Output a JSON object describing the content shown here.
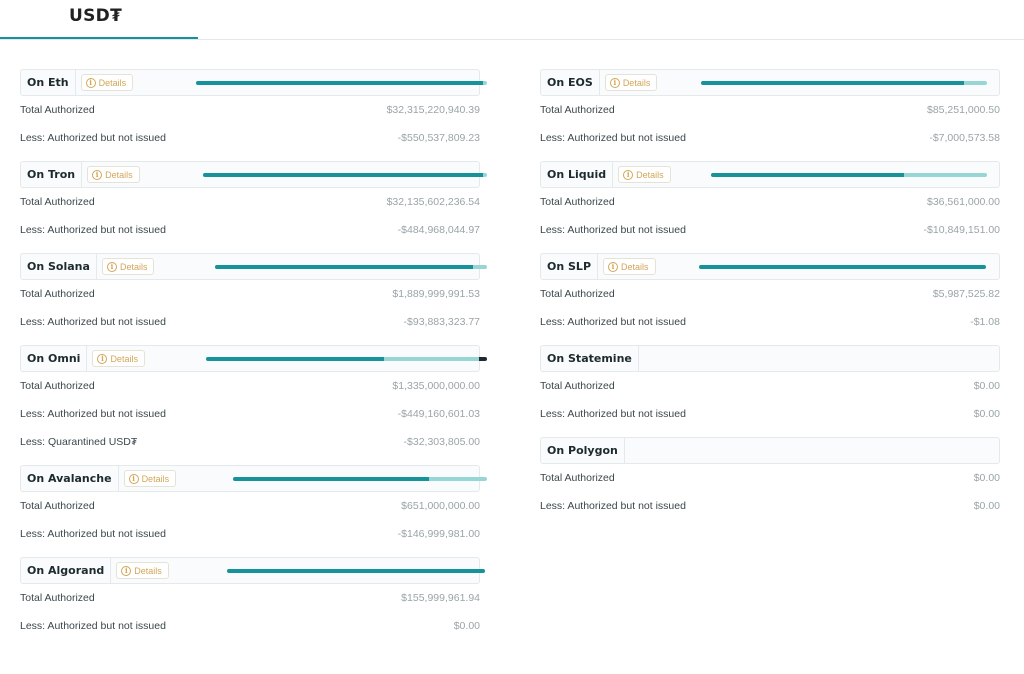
{
  "tab": {
    "title": "USD₮"
  },
  "details_label": "Details",
  "colors": {
    "issued": "#16929a",
    "unissued": "#98d6d6",
    "quarantined": "#1d2a2e"
  },
  "left_column": [
    {
      "name": "On Eth",
      "has_details": true,
      "allocation": [
        0.985,
        0.015,
        0
      ],
      "rows": [
        {
          "label": "Total Authorized",
          "value": "$32,315,220,940.39"
        },
        {
          "label": "Less: Authorized but not issued",
          "value": "-$550,537,809.23"
        }
      ]
    },
    {
      "name": "On Tron",
      "has_details": true,
      "allocation": [
        0.985,
        0.015,
        0
      ],
      "rows": [
        {
          "label": "Total Authorized",
          "value": "$32,135,602,236.54"
        },
        {
          "label": "Less: Authorized but not issued",
          "value": "-$484,968,044.97"
        }
      ]
    },
    {
      "name": "On Solana",
      "has_details": true,
      "allocation": [
        0.95,
        0.05,
        0
      ],
      "rows": [
        {
          "label": "Total Authorized",
          "value": "$1,889,999,991.53"
        },
        {
          "label": "Less: Authorized but not issued",
          "value": "-$93,883,323.77"
        }
      ]
    },
    {
      "name": "On Omni",
      "has_details": true,
      "allocation": [
        0.64,
        0.34,
        0.03
      ],
      "rows": [
        {
          "label": "Total Authorized",
          "value": "$1,335,000,000.00"
        },
        {
          "label": "Less: Authorized but not issued",
          "value": "-$449,160,601.03"
        },
        {
          "label": "Less: Quarantined USD₮",
          "value": "-$32,303,805.00"
        }
      ]
    },
    {
      "name": "On Avalanche",
      "has_details": true,
      "allocation": [
        0.77,
        0.23,
        0
      ],
      "rows": [
        {
          "label": "Total Authorized",
          "value": "$651,000,000.00"
        },
        {
          "label": "Less: Authorized but not issued",
          "value": "-$146,999,981.00"
        }
      ]
    },
    {
      "name": "On Algorand",
      "has_details": true,
      "allocation": [
        1.0,
        0,
        0
      ],
      "rows": [
        {
          "label": "Total Authorized",
          "value": "$155,999,961.94"
        },
        {
          "label": "Less: Authorized but not issued",
          "value": "$0.00"
        }
      ]
    }
  ],
  "right_column": [
    {
      "name": "On EOS",
      "has_details": true,
      "allocation": [
        0.92,
        0.08,
        0
      ],
      "rows": [
        {
          "label": "Total Authorized",
          "value": "$85,251,000.50"
        },
        {
          "label": "Less: Authorized but not issued",
          "value": "-$7,000,573.58"
        }
      ]
    },
    {
      "name": "On Liquid",
      "has_details": true,
      "allocation": [
        0.7,
        0.3,
        0
      ],
      "rows": [
        {
          "label": "Total Authorized",
          "value": "$36,561,000.00"
        },
        {
          "label": "Less: Authorized but not issued",
          "value": "-$10,849,151.00"
        }
      ]
    },
    {
      "name": "On SLP",
      "has_details": true,
      "allocation": [
        1.0,
        0,
        0
      ],
      "rows": [
        {
          "label": "Total Authorized",
          "value": "$5,987,525.82"
        },
        {
          "label": "Less: Authorized but not issued",
          "value": "-$1.08"
        }
      ]
    },
    {
      "name": "On Statemine",
      "has_details": false,
      "allocation": [
        0,
        0,
        0
      ],
      "rows": [
        {
          "label": "Total Authorized",
          "value": "$0.00"
        },
        {
          "label": "Less: Authorized but not issued",
          "value": "$0.00"
        }
      ]
    },
    {
      "name": "On Polygon",
      "has_details": false,
      "allocation": [
        0,
        0,
        0
      ],
      "rows": [
        {
          "label": "Total Authorized",
          "value": "$0.00"
        },
        {
          "label": "Less: Authorized but not issued",
          "value": "$0.00"
        }
      ]
    }
  ]
}
